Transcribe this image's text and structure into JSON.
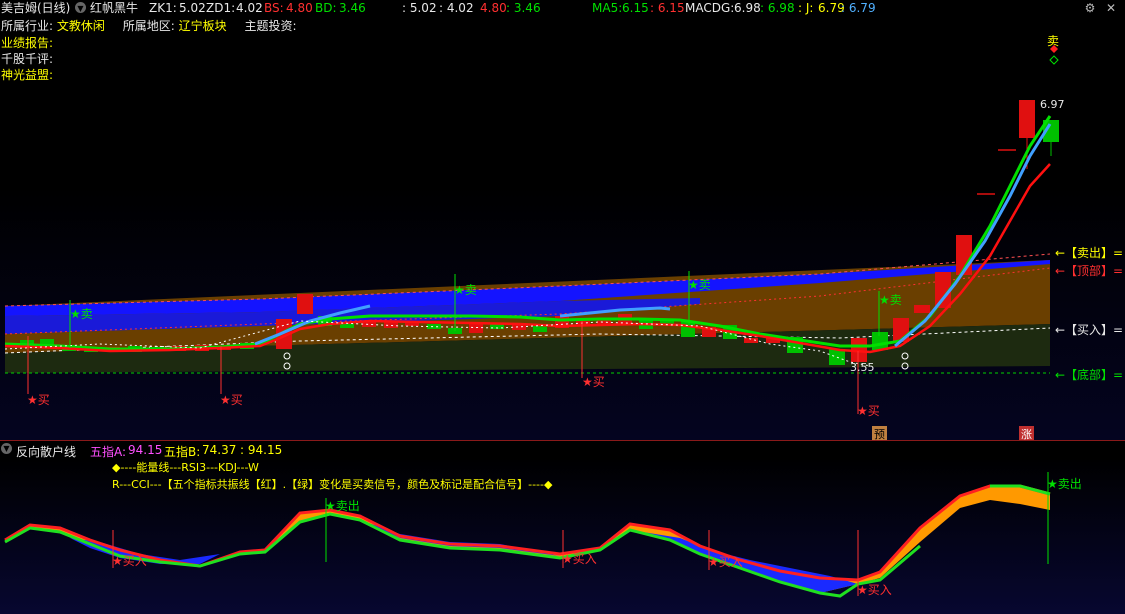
{
  "header": {
    "stock": "美吉姆(日线)",
    "indicator": "红帆黑牛",
    "zk1_label": "ZK1:",
    "zk1": "5.02",
    "zd1_label": "ZD1:",
    "zd1": "4.02",
    "bs_label": "BS:",
    "bs": "4.80",
    "bd_label": "BD:",
    "bd": "3.46",
    "v1": ": 5.02",
    "v2": ": 4.02",
    "v3": "4.80",
    "v4": ": 3.46",
    "ma5_label": "MA5:",
    "ma5": "6.15",
    "ma5b": ": 6.15",
    "macdg_label": "MACDG:",
    "macdg": "6.98",
    "macdg2": ": 6.98",
    "j_label": ": J:",
    "j": "6.79",
    "j2": ": 6.79",
    "colors": {
      "accent_yellow": "#ffff00",
      "up": "#ff3030",
      "down": "#00e000",
      "blue": "#50b0ff"
    }
  },
  "info": {
    "industry_label": "所属行业:",
    "industry": "文教休闲",
    "region_label": "所属地区:",
    "region": "辽宁板块",
    "theme_label": "主题投资:",
    "report_label": "业绩报告:",
    "comment_label": "千股千评:",
    "alliance_label": "神光益盟:"
  },
  "main_chart": {
    "right_labels": {
      "sell": "←【卖出】=",
      "top": "←【顶部】=",
      "buy": "←【买入】=",
      "bottom": "←【底部】="
    },
    "signals": {
      "buy": "★买",
      "sell": "★卖"
    },
    "price_high": "6.97",
    "price_low": "3.55",
    "corner_sell": "卖",
    "pre_label": "预",
    "rise_label": "涨"
  },
  "sub_chart": {
    "title": "反向散户线",
    "a_label": "五指A:",
    "a": "94.15",
    "b_label": "五指B:",
    "b": "74.37",
    "c": ": 94.15",
    "note1": "◆----能量线---RSI3---KDJ---W",
    "note2": "R---CCI---【五个指标共振线【红】.【绿】变化是买卖信号，颜色及标记是配合信号】----◆",
    "buy_signal": "★买入",
    "sell_signal": "★卖出"
  },
  "icons": [
    "settings-icon",
    "close-icon"
  ]
}
